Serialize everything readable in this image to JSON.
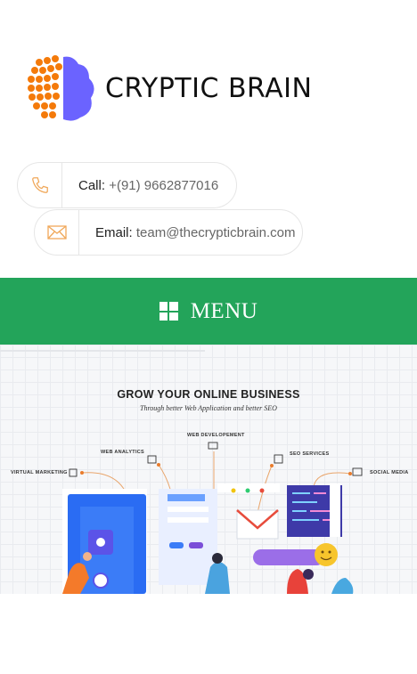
{
  "brand": {
    "name": "CRYPTIC BRAIN",
    "colors": {
      "orange": "#f47a0a",
      "purple": "#6b63ff"
    }
  },
  "contact": {
    "call": {
      "label": "Call:",
      "value": "+(91) 9662877016",
      "icon": "phone-icon"
    },
    "email": {
      "label": "Email:",
      "value": "team@thecrypticbrain.com",
      "icon": "envelope-icon"
    }
  },
  "menu": {
    "label": "MENU",
    "icon": "grid-icon",
    "background": "#23a45a"
  },
  "hero": {
    "title": "GROW YOUR ONLINE BUSINESS",
    "subtitle": "Through better Web Application and better SEO",
    "labels": {
      "web_development": "WEB DEVELOPEMENT",
      "web_analytics": "WEB ANALYTICS",
      "virtual_marketing": "VIRTUAL MARKETING",
      "seo_services": "SEO SERVICES",
      "social_media": "SOCIAL MEDIA"
    }
  }
}
